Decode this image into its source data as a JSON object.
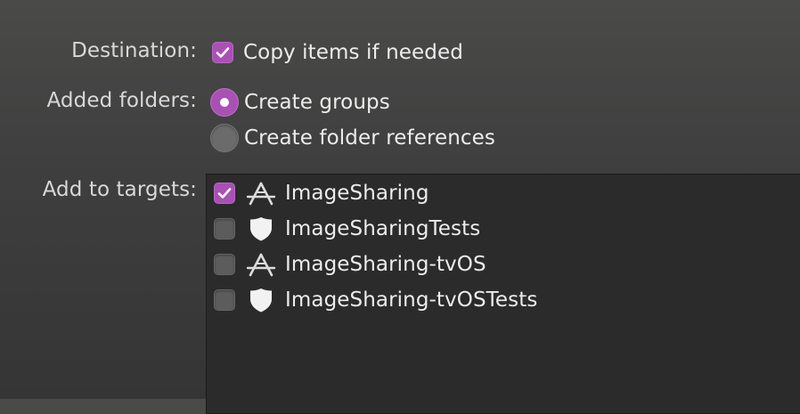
{
  "destination": {
    "label": "Destination:",
    "checkbox_label": "Copy items if needed",
    "checked": true
  },
  "added_folders": {
    "label": "Added folders:",
    "options": [
      {
        "label": "Create groups",
        "selected": true
      },
      {
        "label": "Create folder references",
        "selected": false
      }
    ]
  },
  "add_to_targets": {
    "label": "Add to targets:",
    "targets": [
      {
        "label": "ImageSharing",
        "checked": true,
        "icon": "app-target-icon"
      },
      {
        "label": "ImageSharingTests",
        "checked": false,
        "icon": "test-bundle-icon"
      },
      {
        "label": "ImageSharing-tvOS",
        "checked": false,
        "icon": "app-target-icon"
      },
      {
        "label": "ImageSharing-tvOSTests",
        "checked": false,
        "icon": "test-bundle-icon"
      }
    ]
  },
  "colors": {
    "accent": "#a950b5",
    "background": "#404040",
    "list_background": "#2b2b2b"
  }
}
